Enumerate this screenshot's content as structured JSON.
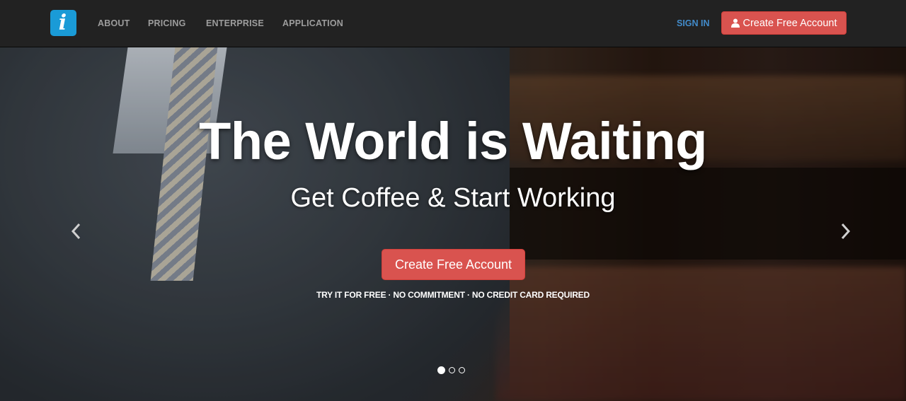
{
  "navbar": {
    "logo_icon": "info-i-icon",
    "items": [
      "ABOUT",
      "PRICING",
      "ENTERPRISE",
      "APPLICATION"
    ],
    "signin_label": "SIGN IN",
    "create_account_label": "Create Free Account",
    "create_account_icon": "user-icon"
  },
  "hero": {
    "title": "The World is Waiting",
    "subtitle": "Get Coffee & Start Working",
    "cta_label": "Create Free Account",
    "tagline": "TRY IT FOR FREE · NO COMMITMENT · NO CREDIT CARD REQUIRED",
    "prev_icon": "chevron-left-icon",
    "next_icon": "chevron-right-icon",
    "slides": 3,
    "active_slide": 1
  },
  "colors": {
    "navbar_bg": "#222222",
    "brand": "#1a9bd7",
    "signin": "#428bca",
    "danger_button": "#d9534f"
  }
}
